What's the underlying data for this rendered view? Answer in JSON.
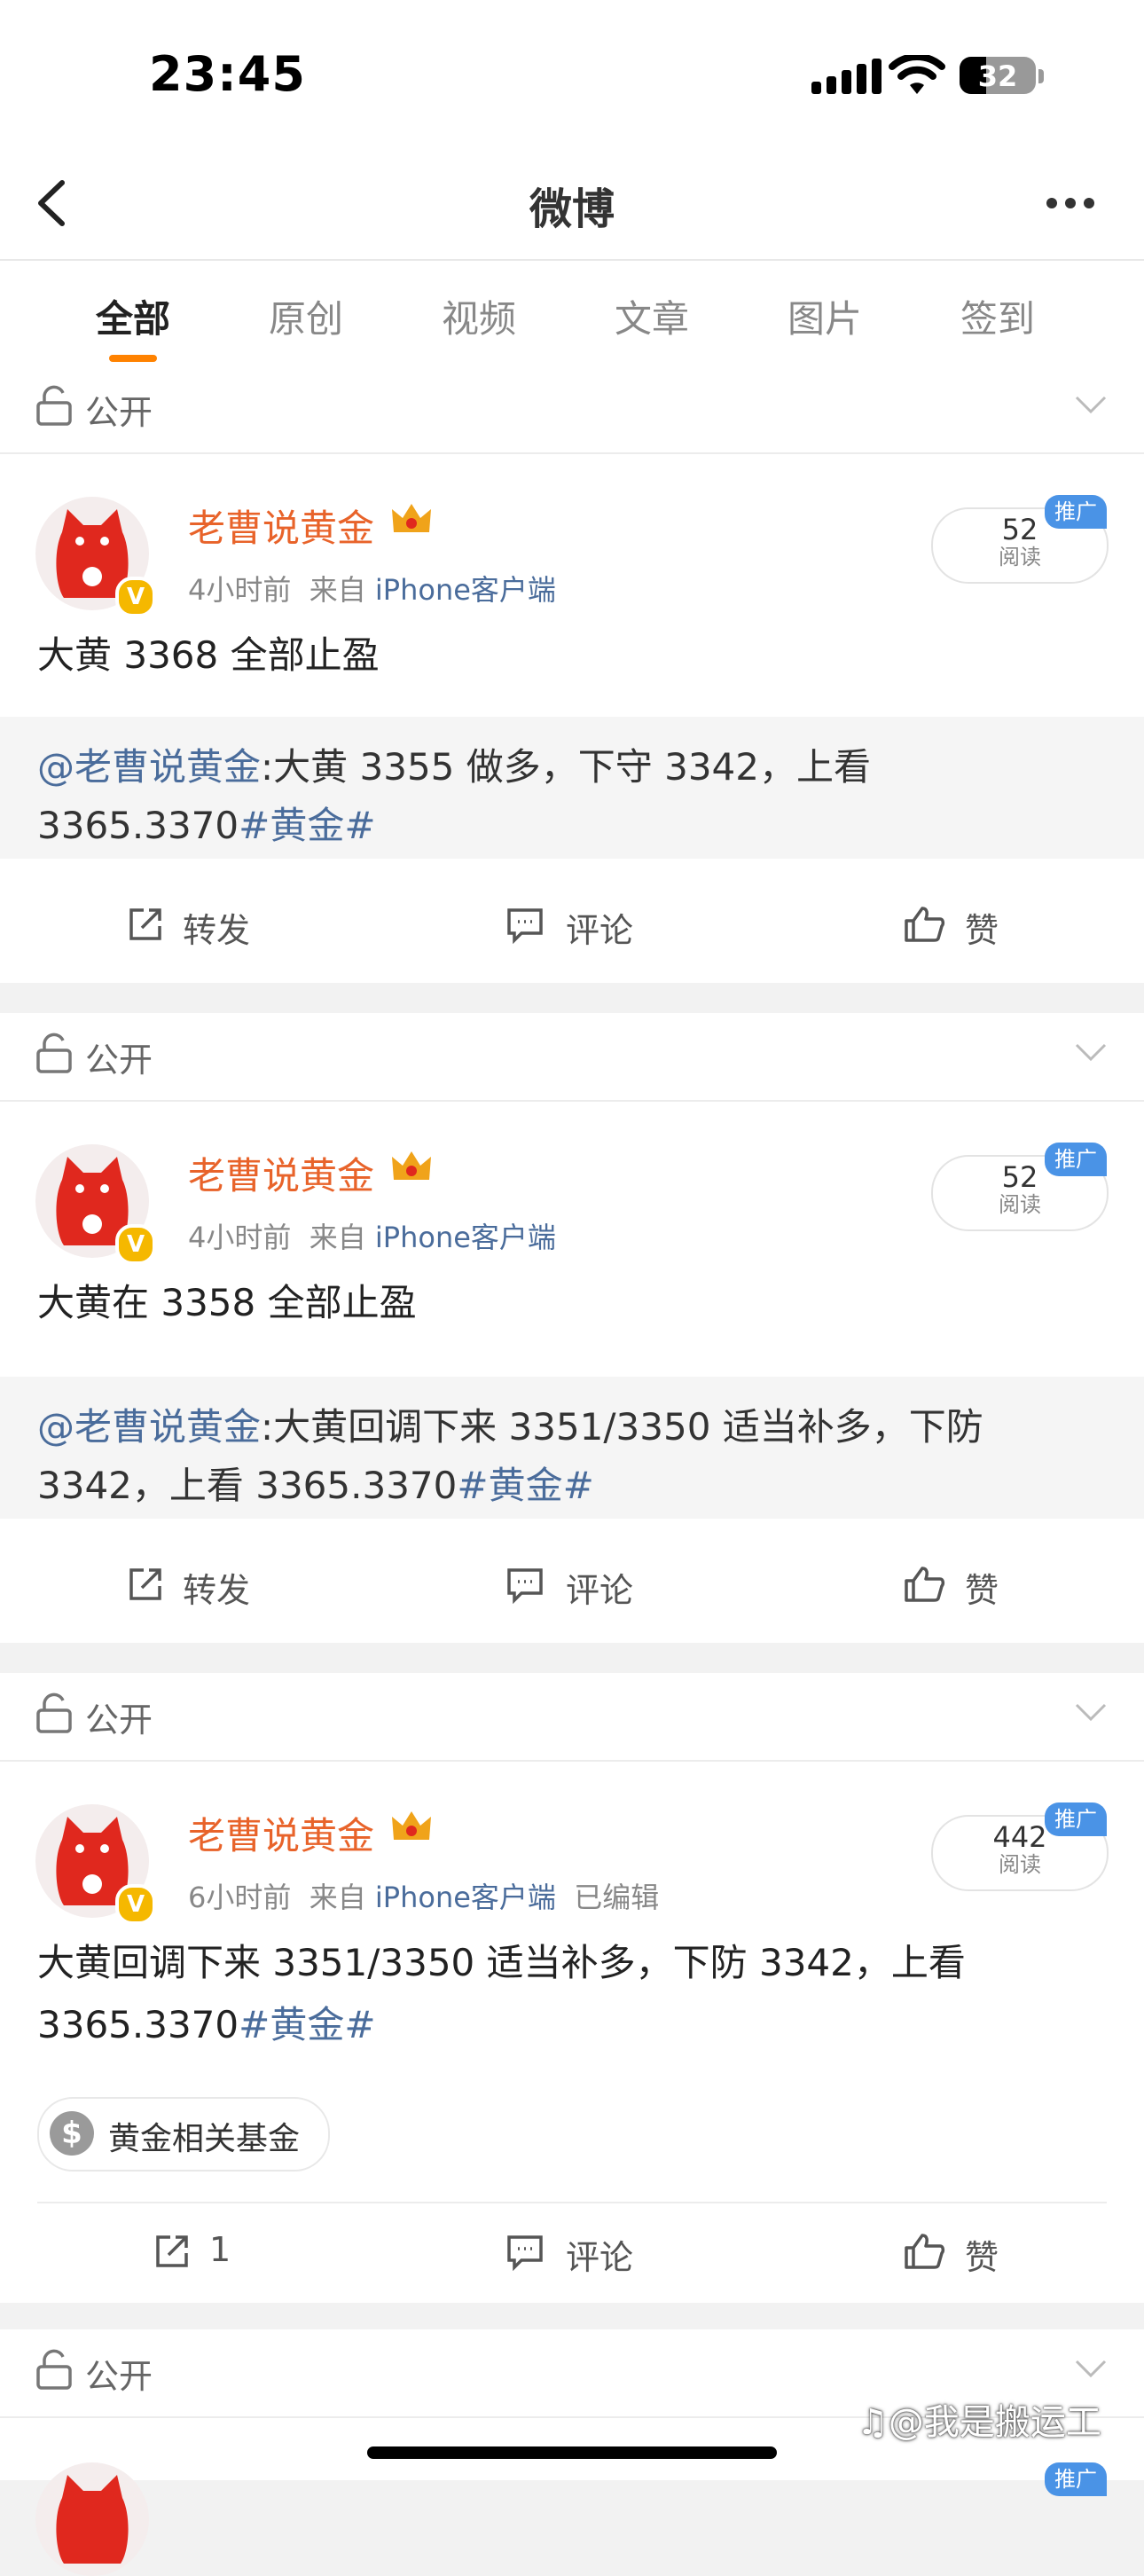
{
  "status_bar": {
    "time": "23:45",
    "battery": "32"
  },
  "nav": {
    "title": "微博"
  },
  "tabs": [
    {
      "label": "全部",
      "active": true
    },
    {
      "label": "原创"
    },
    {
      "label": "视频"
    },
    {
      "label": "文章"
    },
    {
      "label": "图片"
    },
    {
      "label": "签到"
    }
  ],
  "posts": [
    {
      "visibility": "公开",
      "author": "老曹说黄金",
      "time": "4小时前",
      "from_label": "来自",
      "source": "iPhone客户端",
      "edited": "",
      "reads": "52",
      "reads_label": "阅读",
      "promo": "推广",
      "text": "大黄 3368 全部止盈",
      "quote": {
        "at": "@老曹说黄金",
        "text": ":大黄 3355 做多，下守 3342，上看 3365.3370",
        "topic": "#黄金#"
      },
      "actions": {
        "repost": "转发",
        "comment": "评论",
        "like": "赞"
      }
    },
    {
      "visibility": "公开",
      "author": "老曹说黄金",
      "time": "4小时前",
      "from_label": "来自",
      "source": "iPhone客户端",
      "edited": "",
      "reads": "52",
      "reads_label": "阅读",
      "promo": "推广",
      "text": "大黄在 3358 全部止盈",
      "quote": {
        "at": "@老曹说黄金",
        "text": ":大黄回调下来 3351/3350 适当补多，下防 3342，上看 3365.3370",
        "topic": "#黄金#"
      },
      "actions": {
        "repost": "转发",
        "comment": "评论",
        "like": "赞"
      }
    },
    {
      "visibility": "公开",
      "author": "老曹说黄金",
      "time": "6小时前",
      "from_label": "来自",
      "source": "iPhone客户端",
      "edited": "已编辑",
      "reads": "442",
      "reads_label": "阅读",
      "promo": "推广",
      "text": "大黄回调下来 3351/3350 适当补多，下防 3342，上看 3365.3370",
      "topic": "#黄金#",
      "fund_tag": "黄金相关基金",
      "actions": {
        "repost": "1",
        "comment": "评论",
        "like": "赞"
      }
    },
    {
      "visibility": "公开"
    }
  ],
  "watermark": "我是搬运工",
  "colors": {
    "accent": "#ff8200",
    "username": "#e8632a",
    "link": "#4a6c9b",
    "promo": "#4a93e6",
    "verified": "#f5b800"
  }
}
